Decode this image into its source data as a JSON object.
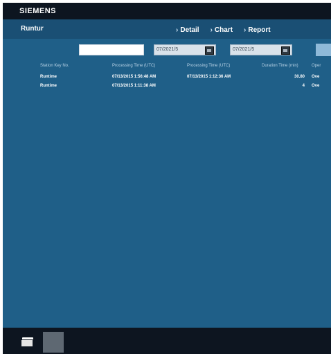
{
  "header": {
    "brand": "SIEMENS"
  },
  "subheader": {
    "title": "Runtur",
    "nav": [
      {
        "label": "Detail"
      },
      {
        "label": "Chart"
      },
      {
        "label": "Report"
      }
    ]
  },
  "filters": {
    "search_value": "",
    "date_from": "07/2021/5",
    "date_to": "07/2021/5"
  },
  "table": {
    "columns": [
      "Station Key No.",
      "Processing Time (UTC)",
      "Processing Time (UTC)",
      "Duration Time (min)",
      "Oper"
    ],
    "rows": [
      [
        "Runtime",
        "07/13/2015 1:56:48 AM",
        "07/13/2015 1:12:36 AM",
        "30.80",
        "Ove"
      ],
      [
        "Runtime",
        "07/13/2015 1:11:38 AM",
        "",
        "4",
        "Ove"
      ]
    ]
  },
  "colors": {
    "background": "#1f5f88",
    "topbar": "#0d1520",
    "subbar": "#1a4f74"
  },
  "icons": [
    "calendar-icon",
    "folder-icon"
  ]
}
